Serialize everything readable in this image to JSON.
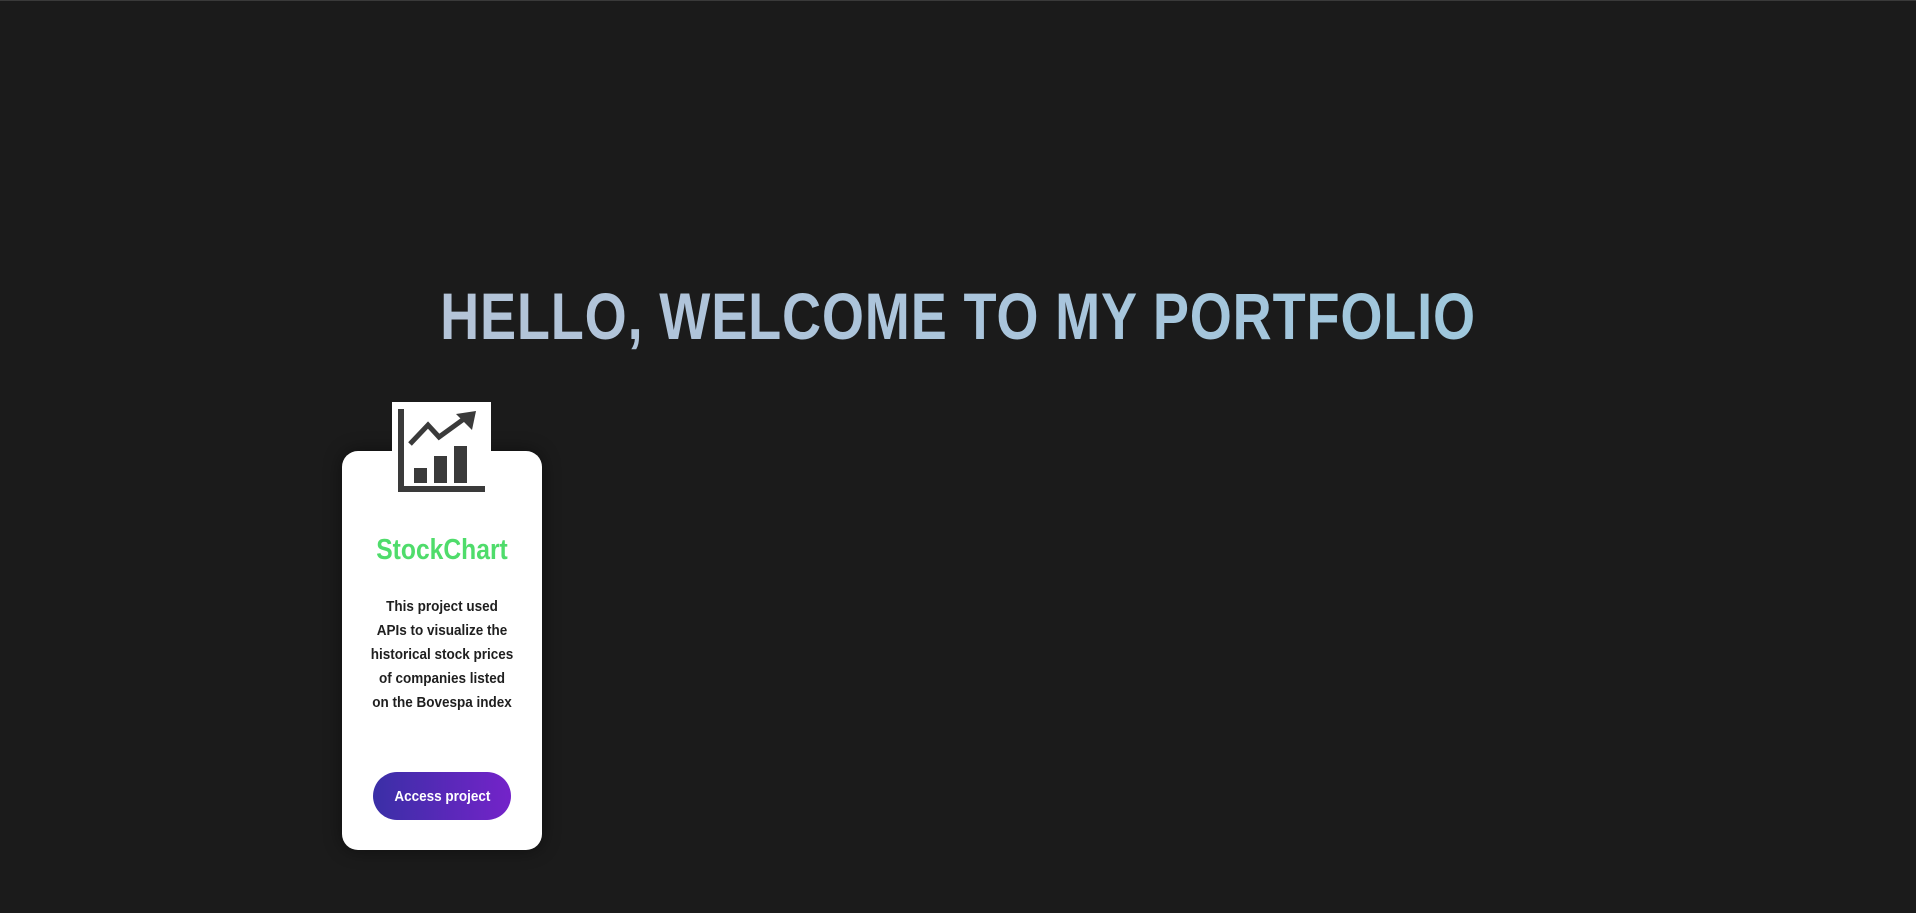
{
  "page": {
    "title": "HELLO, WELCOME TO MY PORTFOLIO"
  },
  "projects": [
    {
      "icon": "stock-chart-icon",
      "title": "StockChart",
      "description": "This project used APIs to visualize the historical stock prices of companies listed on the Bovespa index",
      "button_label": "Access project"
    }
  ],
  "colors": {
    "background": "#1b1b1b",
    "title_gradient_start": "#b9c3d6",
    "title_gradient_end": "#98c9dc",
    "card_background": "#ffffff",
    "project_title": "#4fdc6b",
    "button_gradient_start": "#3a2fa6",
    "button_gradient_end": "#7423c9"
  }
}
